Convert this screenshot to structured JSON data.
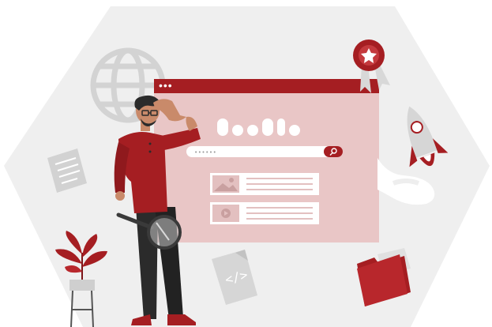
{
  "browser": {
    "window_dots": "•••",
    "search_placeholder": "••••••"
  },
  "file_icon": {
    "label": "</>"
  },
  "colors": {
    "accent": "#a51e22",
    "accent_dark": "#7c1518",
    "window_body": "#e9c6c6",
    "hexagon_bg": "#efefef",
    "illustration_gray": "#d6d6d6"
  }
}
